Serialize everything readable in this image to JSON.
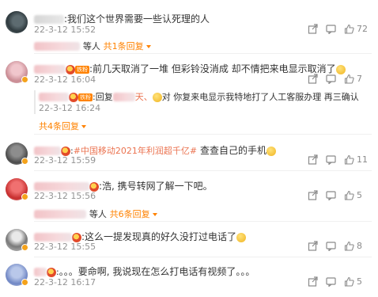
{
  "comments": [
    {
      "text": ":我们这个世界需要一些认死理的人",
      "time": "22-3-12 15:52",
      "likes": "72",
      "replies_summary": {
        "tail": "等人",
        "link": "共1条回复"
      }
    },
    {
      "text": ":前几天取消了一堆 但彩铃没消成 却不情把来电显示取消了",
      "time": "22-3-12 16:04",
      "likes": "7",
      "reply": {
        "prefix": ":回复",
        "mention_tail": "天、",
        "text": "对 你复来电显示我特地打了人工客服办理 再三确认",
        "time": "22-3-12 16:24"
      },
      "replies_summary": {
        "link": "共4条回复"
      }
    },
    {
      "hashtag": "#中国移动2021年利润超千亿#",
      "text": " 查查自己的手机",
      "time": "22-3-12 15:59",
      "likes": "11"
    },
    {
      "text": ":浩, 携号转网了解一下吧。",
      "time": "22-3-12 15:56",
      "likes": "5",
      "replies_summary": {
        "tail": "等人",
        "link": "共6条回复"
      }
    },
    {
      "text": ":这么一提发现真的好久没打过电话了",
      "time": "22-3-12 15:55",
      "likes": "8"
    },
    {
      "text": "。。。要命啊, 我说现在怎么打电话有视频了。。。",
      "time": "22-3-12 16:17",
      "likes": "5"
    }
  ],
  "badge_text": "铁粉",
  "icons": [
    "share-icon",
    "comment-icon",
    "like-icon"
  ],
  "colors": {
    "accent": "#ff8200",
    "link": "#eb7350",
    "meta": "#939393"
  }
}
